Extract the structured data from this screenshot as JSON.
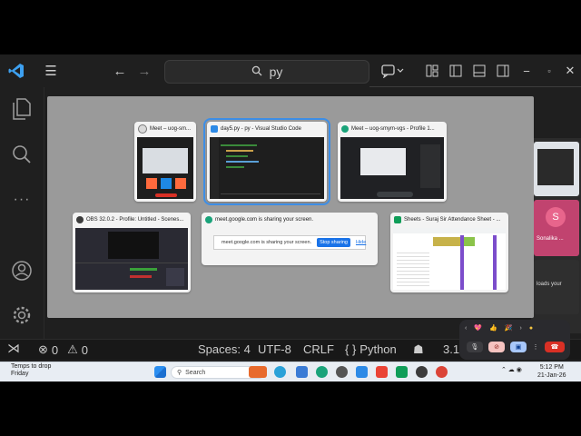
{
  "vscode": {
    "search_text": "py",
    "statusbar": {
      "errors": "0",
      "warnings": "0",
      "spaces": "Spaces: 4",
      "encoding": "UTF-8",
      "line_ending": "CRLF",
      "language": "Python",
      "version_partial": "3.1"
    }
  },
  "switcher": {
    "windows": [
      {
        "title": "Meet – uog-sm...",
        "app": "chrome"
      },
      {
        "title": "day5.py - py - Visual Studio Code",
        "app": "vscode"
      },
      {
        "title": "Meet – uog-smym-vgs - Profile 1...",
        "app": "chrome"
      },
      {
        "title": "OBS 32.0.2 - Profile: Untitled - Scenes...",
        "app": "obs"
      },
      {
        "title": "meet.google.com is sharing your screen.",
        "app": "chrome"
      },
      {
        "title": "Sheets - Suraj Sir Attendance Sheet - ...",
        "app": "sheets"
      }
    ],
    "share_bar": {
      "message": "meet.google.com is sharing your screen.",
      "stop_label": "Stop sharing",
      "hide_label": "Hide"
    }
  },
  "meet_panel": {
    "avatar_letter": "S",
    "participant_name": "Sonalika ...",
    "caption": "loads your"
  },
  "taskbar": {
    "weather_line1": "Temps to drop",
    "weather_line2": "Friday",
    "search_placeholder": "Search",
    "time": "5:12 PM",
    "date": "21-Jan-26"
  },
  "colors": {
    "vscode_bg": "#1f1f1f",
    "selection_outline": "#3d8ee6",
    "stop_sharing": "#1a73e8",
    "meet_end_call": "#d93025"
  }
}
